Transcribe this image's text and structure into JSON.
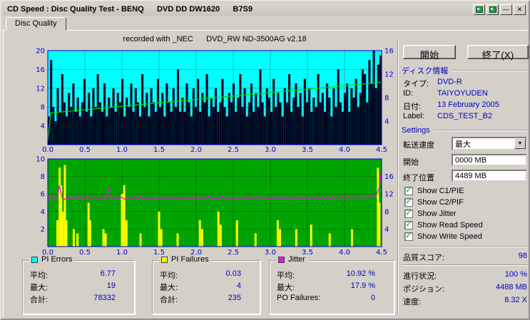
{
  "window": {
    "title": "CD Speed : Disc Quality Test - BENQ      DVD DD DW1620      B7S9",
    "buttons": {
      "minimize": "—",
      "close": "✕"
    }
  },
  "tab": {
    "label": "Disc Quality"
  },
  "chart_data": [
    {
      "type": "bar",
      "name": "PI Errors vs position with write speed line",
      "title": "recorded with _NEC      DVD_RW ND-3500AG v2.18",
      "x_min": 0,
      "x_max": 4.5,
      "x_tick_labels": [
        "0.0",
        "0.5",
        "1.0",
        "1.5",
        "2.0",
        "2.5",
        "3.0",
        "3.5",
        "4.0",
        "4.5"
      ],
      "left_ticks": [
        20,
        16,
        12,
        8,
        4
      ],
      "left_max": 20,
      "right_ticks": [
        16,
        12,
        8,
        4
      ],
      "right_max": 16,
      "bg": "#00ffff",
      "grid": "#00c6c6",
      "border": "#0000e0",
      "axis_color": "#0000d0",
      "bar_color": "#000820",
      "bar_values": [
        6,
        18,
        8,
        5,
        12,
        7,
        15,
        9,
        6,
        11,
        8,
        13,
        7,
        10,
        6,
        9,
        14,
        7,
        11,
        6,
        12,
        8,
        15,
        9,
        7,
        13,
        6,
        10,
        8,
        12,
        7,
        11,
        9,
        14,
        6,
        10,
        8,
        13,
        7,
        12,
        9,
        6,
        15,
        8,
        11,
        6,
        12,
        9,
        7,
        14,
        8,
        11,
        6,
        13,
        9,
        7,
        12,
        8,
        16,
        7,
        10,
        7,
        13,
        9,
        6,
        12,
        8,
        14,
        7,
        11,
        9,
        15,
        6,
        10,
        8,
        12,
        7,
        9,
        14,
        8,
        6,
        11,
        9,
        13,
        7,
        10,
        15,
        8,
        12,
        6,
        9,
        13,
        7,
        11,
        8,
        16,
        9,
        6,
        12,
        10,
        7,
        14,
        8,
        11,
        9,
        6,
        12,
        9,
        15,
        7,
        10,
        13,
        8,
        11,
        6,
        14,
        9,
        12,
        7,
        10,
        8,
        15,
        9,
        11,
        7,
        13,
        10,
        6,
        12,
        8,
        16,
        9,
        7,
        11,
        13,
        7,
        12,
        10,
        14,
        8,
        11,
        16,
        15,
        9,
        18,
        13,
        20,
        12,
        17,
        19
      ],
      "line_name": "Write Speed (X)",
      "line_color": "#00e400",
      "line_points": [
        [
          0,
          0.6
        ],
        [
          0.04,
          5.4
        ],
        [
          4.49,
          10.6
        ]
      ]
    },
    {
      "type": "bar",
      "name": "PI Failures vs position with jitter line",
      "x_min": 0,
      "x_max": 4.5,
      "x_tick_labels": [
        "0.0",
        "0.5",
        "1.0",
        "1.5",
        "2.0",
        "2.5",
        "3.0",
        "3.5",
        "4.0",
        "4.5"
      ],
      "left_ticks": [
        10,
        8,
        6,
        4,
        2
      ],
      "left_max": 10,
      "right_ticks": [
        16,
        12,
        8,
        4
      ],
      "right_max": 20,
      "bg": "#00a400",
      "grid": "#007c00",
      "border": "#0000c0",
      "axis_color": "#0000d0",
      "bar_color": "#ffff00",
      "bar_points": [
        [
          0.13,
          3
        ],
        [
          0.16,
          9
        ],
        [
          0.18,
          7
        ],
        [
          0.2,
          4
        ],
        [
          0.23,
          9.3
        ],
        [
          0.25,
          3
        ],
        [
          0.35,
          2
        ],
        [
          0.4,
          1.5
        ],
        [
          0.55,
          5
        ],
        [
          0.57,
          3
        ],
        [
          0.75,
          2
        ],
        [
          0.78,
          1.5
        ],
        [
          1.0,
          6
        ],
        [
          1.03,
          7
        ],
        [
          1.06,
          3
        ],
        [
          1.25,
          1.5
        ],
        [
          1.5,
          4
        ],
        [
          1.53,
          2
        ],
        [
          1.75,
          1.5
        ],
        [
          2.05,
          3
        ],
        [
          2.08,
          2
        ],
        [
          2.3,
          4
        ],
        [
          2.33,
          2.5
        ],
        [
          2.55,
          3
        ],
        [
          2.8,
          1.5
        ],
        [
          3.1,
          3
        ],
        [
          3.13,
          2
        ],
        [
          3.35,
          2
        ],
        [
          3.55,
          2.5
        ],
        [
          3.8,
          1.5
        ],
        [
          4.1,
          2
        ],
        [
          4.45,
          9
        ],
        [
          4.47,
          5
        ]
      ],
      "line_name": "Jitter (%)",
      "line_color": "#ff00ff",
      "line_values": [
        11.2,
        10.8,
        11.5,
        10.6,
        11.0,
        14.0,
        11.3,
        10.7,
        11.1,
        10.9,
        11.4,
        10.8,
        11.0,
        11.6,
        10.7,
        11.2,
        10.9,
        11.5,
        11.0,
        10.6,
        11.3,
        11.0,
        10.8,
        11.4,
        10.9,
        11.2,
        13.5,
        11.0,
        10.7,
        11.3,
        10.9,
        11.5,
        11.1,
        10.8,
        11.2,
        11.0,
        10.6,
        11.4,
        11.0,
        10.9,
        11.6,
        10.8,
        11.2,
        11.0,
        10.7,
        11.3,
        10.9,
        11.1,
        11.5,
        10.8,
        11.0,
        11.2,
        10.6,
        11.4,
        11.0,
        10.9,
        11.3,
        10.7,
        11.1,
        11.0,
        10.8,
        11.2,
        11.6,
        10.9,
        11.0,
        11.4,
        10.7,
        11.2,
        10.9,
        11.5,
        11.0,
        10.8,
        11.3,
        10.9,
        11.1,
        11.6,
        10.8,
        11.0,
        11.4,
        10.9,
        11.2,
        10.6,
        11.0,
        11.3,
        10.9,
        11.5,
        11.0,
        10.8,
        11.2,
        11.0,
        11.6,
        10.7,
        11.1,
        11.3,
        10.9,
        11.0,
        11.2,
        10.8,
        11.4,
        11.0,
        10.9,
        11.5,
        10.8,
        11.1,
        11.0,
        11.3,
        10.7,
        11.2,
        11.0,
        11.6,
        10.9,
        11.2,
        10.8,
        11.3,
        11.0,
        11.5,
        10.9,
        11.1,
        11.4,
        10.8,
        11.2,
        11.0,
        11.5,
        10.9,
        11.3,
        11.1,
        11.6,
        11.0,
        11.2,
        11.4,
        10.9,
        11.3,
        11.1,
        11.5,
        11.2,
        11.7,
        11.0,
        11.4,
        11.8,
        11.2,
        11.6,
        12.0,
        13.5,
        17.9
      ]
    }
  ],
  "legend": {
    "pi_errors": {
      "title": "PI Errors",
      "swatch": "#00ffff",
      "rows": [
        {
          "label": "平均:",
          "value": "6.77"
        },
        {
          "label": "最大:",
          "value": "19"
        },
        {
          "label": "合計:",
          "value": "78332"
        }
      ]
    },
    "pi_failures": {
      "title": "PI Failures",
      "swatch": "#ffff00",
      "rows": [
        {
          "label": "平均:",
          "value": "0.03"
        },
        {
          "label": "最大:",
          "value": "4"
        },
        {
          "label": "合計:",
          "value": "235"
        }
      ]
    },
    "jitter": {
      "title": "Jitter",
      "swatch": "#ff00ff",
      "rows": [
        {
          "label": "平均:",
          "value": "10.92 %"
        },
        {
          "label": "最大:",
          "value": "17.9 %"
        },
        {
          "label": "PO Failures:",
          "value": "0"
        }
      ]
    }
  },
  "panel": {
    "start_button": "開始",
    "exit_button": "終了(X)",
    "disc_info": {
      "header": "ディスク情報",
      "rows": [
        {
          "label": "タイプ:",
          "value": "DVD-R"
        },
        {
          "label": "ID:",
          "value": "TAIYOYUDEN"
        },
        {
          "label": "日付:",
          "value": "13 February 2005"
        },
        {
          "label": "Label:",
          "value": "CDS_TEST_B2"
        }
      ]
    },
    "settings": {
      "header": "Settings",
      "speed_label": "転送速度",
      "speed_value": "最大",
      "dropdown_arrow": "▼",
      "start_label": "開始",
      "start_value": "0000 MB",
      "end_label": "終了位置",
      "end_value": "4489 MB",
      "check_glyph": "✓",
      "checkboxes": [
        {
          "label": "Show C1/PIE",
          "checked": true
        },
        {
          "label": "Show C2/PIF",
          "checked": true
        },
        {
          "label": "Show Jitter",
          "checked": true
        },
        {
          "label": "Show Read Speed",
          "checked": true
        },
        {
          "label": "Show Write Speed",
          "checked": true
        }
      ]
    },
    "score": {
      "label": "品質スコア:",
      "value": "98"
    },
    "status": [
      {
        "label": "進行状況:",
        "value": "100 %"
      },
      {
        "label": "ポジション:",
        "value": "4488 MB"
      },
      {
        "label": "速度:",
        "value": "8.32 X"
      }
    ]
  }
}
